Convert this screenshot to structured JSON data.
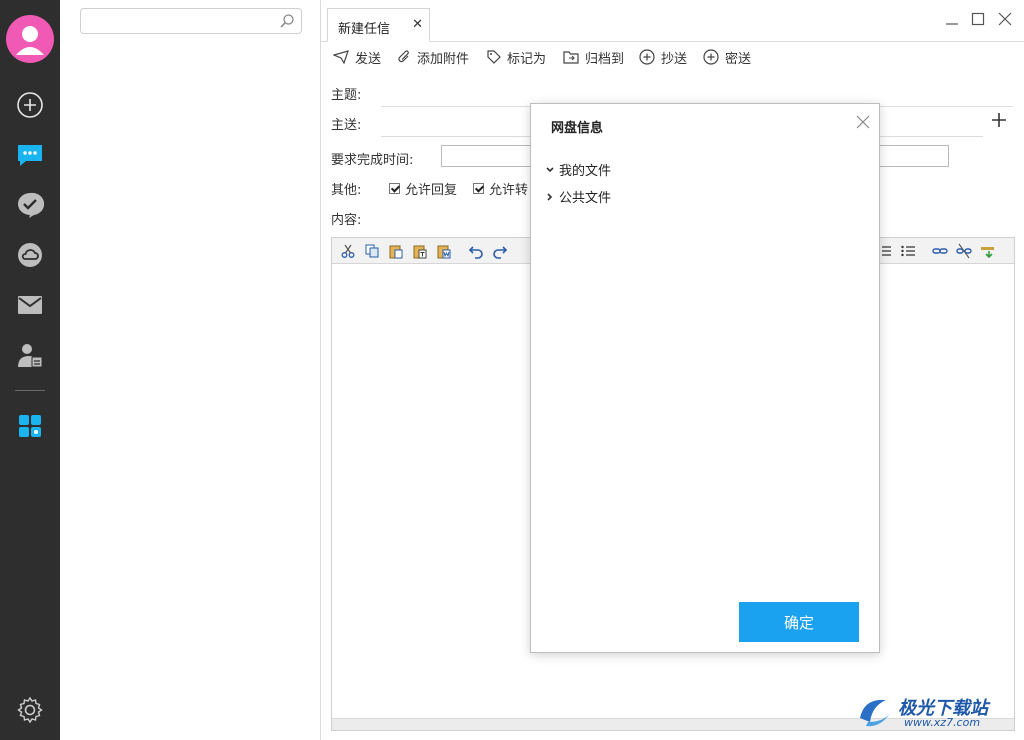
{
  "search": {
    "placeholder": ""
  },
  "tab": {
    "label": "新建任信"
  },
  "toolbar": {
    "send": "发送",
    "attach": "添加附件",
    "mark": "标记为",
    "archive": "归档到",
    "cc": "抄送",
    "bcc": "密送"
  },
  "form": {
    "subject_label": "主题:",
    "to_label": "主送:",
    "deadline_label": "要求完成时间:",
    "other_label": "其他:",
    "allow_reply": "允许回复",
    "allow_forward": "允许转",
    "content_label": "内容:"
  },
  "modal": {
    "title": "网盘信息",
    "tree": [
      {
        "label": "我的文件",
        "expanded": true
      },
      {
        "label": "公共文件",
        "expanded": false
      }
    ],
    "ok_label": "确定"
  },
  "watermark": {
    "name": "极光下载站",
    "url": "www.xz7.com"
  },
  "colors": {
    "rail": "#2e2e2e",
    "avatar": "#f05ab4",
    "accent": "#1aa1f0",
    "message_icon": "#1ab4f0"
  },
  "icons": {
    "rail": [
      "add-icon",
      "message-icon",
      "chat-check-icon",
      "cloud-icon",
      "mail-icon",
      "contacts-icon",
      "apps-icon",
      "settings-icon"
    ]
  }
}
